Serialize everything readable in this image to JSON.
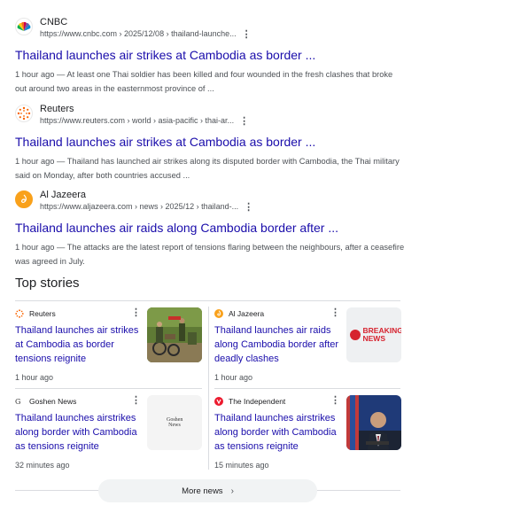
{
  "results": [
    {
      "source": "CNBC",
      "url": "https://www.cnbc.com › 2025/12/08 › thailand-launche...",
      "title": "Thailand launches air strikes at Cambodia as border ...",
      "snippet": "1 hour ago — At least one Thai soldier has been killed and four wounded in the fresh clashes that broke out around two areas in the easternmost province of ...",
      "icon": "cnbc-peacock-icon"
    },
    {
      "source": "Reuters",
      "url": "https://www.reuters.com › world › asia-pacific › thai-ar...",
      "title": "Thailand launches air strikes at Cambodia as border ...",
      "snippet": "1 hour ago — Thailand has launched air strikes along its disputed border with Cambodia, the Thai military said on Monday, after both countries accused ...",
      "icon": "reuters-icon"
    },
    {
      "source": "Al Jazeera",
      "url": "https://www.aljazeera.com › news › 2025/12 › thailand-...",
      "title": "Thailand launches air raids along Cambodia border after ...",
      "snippet": "1 hour ago — The attacks are the latest report of tensions flaring between the neighbours, after a ceasefire was agreed in July.",
      "icon": "aljazeera-icon"
    }
  ],
  "top_stories": {
    "heading": "Top stories",
    "cards": [
      {
        "source": "Reuters",
        "title": "Thailand launches air strikes at Cambodia as border tensions reignite",
        "time": "1 hour ago",
        "thumb": "soldiers-photo"
      },
      {
        "source": "Al Jazeera",
        "title": "Thailand launches air raids along Cambodia border after deadly clashes",
        "time": "1 hour ago",
        "thumb": "breaking-news-graphic",
        "thumb_text": "BREAKING NEWS"
      },
      {
        "source": "Goshen News",
        "title": "Thailand launches airstrikes along border with Cambodia as tensions reignite",
        "time": "32 minutes ago",
        "thumb": "goshen-news-logo",
        "thumb_text": "Goshen News"
      },
      {
        "source": "The Independent",
        "title": "Thailand launches airstrikes along border with Cambodia as tensions reignite",
        "time": "15 minutes ago",
        "thumb": "official-portrait-photo"
      }
    ],
    "more_label": "More news"
  },
  "colors": {
    "link": "#1a0dab",
    "muted": "#4d5156",
    "divider": "#dadce0",
    "breaking_red": "#d6232f",
    "aljazeera_orange": "#f9a11b"
  }
}
